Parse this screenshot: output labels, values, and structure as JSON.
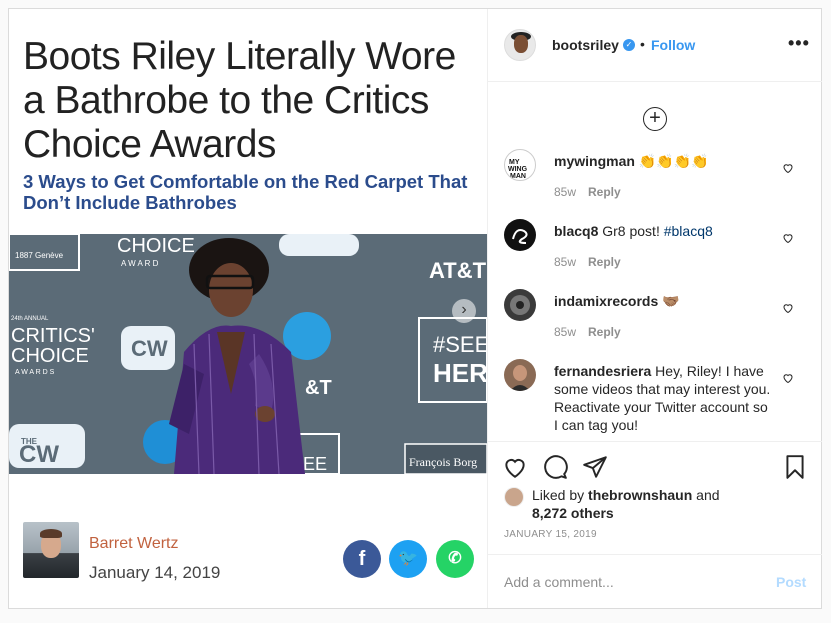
{
  "article": {
    "headline": "Boots Riley Literally Wore a Bathrobe to the Critics Choice Awards",
    "subhead": "3 Ways to Get Comfortable on the Red Carpet That Don’t Include Bathrobes",
    "backdrop": {
      "brand_1887": "1887 Genève",
      "choice_top": "CHOICE",
      "awards_top": "A W A R D",
      "annual": "24th ANNUAL",
      "critics": "CRITICS'",
      "choice": "CHOICE",
      "awards": "A W A R D S",
      "cw": "CW",
      "the": "THE",
      "att": "AT&T",
      "att_partial": "&T",
      "see": "#SEE",
      "her": "HER",
      "francois": "François Borg",
      "ee": "EE"
    },
    "author": "Barret Wertz",
    "date": "January 14, 2019",
    "share": {
      "facebook": "f",
      "twitter": "🐦",
      "whatsapp": "✆"
    }
  },
  "post": {
    "username": "bootsriley",
    "verified_mark": "✓",
    "dot": "•",
    "follow": "Follow",
    "more": "•••",
    "load_more": "+",
    "comments": [
      {
        "username": "mywingman",
        "text": "👏👏👏👏",
        "tag": "",
        "time": "85w",
        "reply": "Reply",
        "avatar_color": "#ffffff"
      },
      {
        "username": "blacq8",
        "text": "Gr8 post! ",
        "tag": "#blacq8",
        "time": "85w",
        "reply": "Reply",
        "avatar_color": "#111111"
      },
      {
        "username": "indamixrecords",
        "text": "🤝🏽",
        "tag": "",
        "time": "85w",
        "reply": "Reply",
        "avatar_color": "#3a3a3a"
      },
      {
        "username": "fernandesriera",
        "text": "Hey, Riley! I have some videos that may interest you. Reactivate your Twitter account so I can tag you!",
        "tag": "",
        "time": "",
        "reply": "",
        "avatar_color": "#8a6a55"
      }
    ],
    "liked_by_prefix": "Liked by ",
    "liked_by_user": "thebrownshaun",
    "liked_by_suffix": " and",
    "likes_count": "8,272 others",
    "date": "JANUARY 15, 2019",
    "add_comment_placeholder": "Add a comment...",
    "post_label": "Post"
  },
  "colors": {
    "accent": "#3897f0",
    "headline_blue": "#2b4c8c",
    "author_orange": "#c1623f",
    "robe_purple": "#4b2a7a"
  },
  "icons": [
    "verified-icon",
    "more-options-icon",
    "load-more-icon",
    "heart-icon",
    "comment-icon",
    "share-icon",
    "bookmark-icon",
    "carousel-next-icon"
  ]
}
